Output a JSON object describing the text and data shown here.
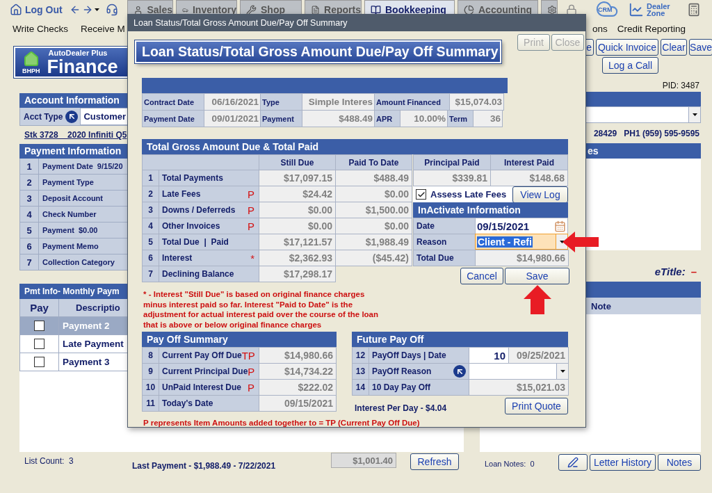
{
  "topbar": {
    "logout": "Log Out",
    "tabs": [
      {
        "label": "Sales",
        "selected": false
      },
      {
        "label": "Inventory",
        "selected": false
      },
      {
        "label": "Shop",
        "selected": false
      },
      {
        "label": "Reports",
        "selected": false
      },
      {
        "label": "Bookkeeping",
        "selected": true
      },
      {
        "label": "Accounting",
        "selected": false
      }
    ],
    "crm": "CRM",
    "dealer_zone": "Dealer Zone"
  },
  "menu": {
    "left": [
      "Write Checks",
      "Receive M"
    ],
    "right": [
      "ons",
      "Credit Reporting"
    ]
  },
  "logo": {
    "badge": "BHPH",
    "subtitle": "AutoDealer Plus",
    "title": "Finance"
  },
  "toolbar": {
    "buttons": [
      "e",
      "Quick Invoice",
      "Clear",
      "Save"
    ],
    "log_call": "Log a Call"
  },
  "account": {
    "title": "Account Information",
    "type_label": "Acct Type",
    "type_value": "Customer",
    "vehicle": "Stk 3728    2020 Infiniti Q5"
  },
  "payment_info": {
    "title": "Payment Information",
    "rows": [
      {
        "num": "1",
        "label": "Payment Date  9/15/20"
      },
      {
        "num": "2",
        "label": "Payment Type"
      },
      {
        "num": "3",
        "label": "Deposit Account"
      },
      {
        "num": "4",
        "label": "Check Number"
      },
      {
        "num": "5",
        "label": "Payment  $0.00"
      },
      {
        "num": "6",
        "label": "Payment Memo"
      },
      {
        "num": "7",
        "label": "Collection Category"
      }
    ]
  },
  "pmt": {
    "title": "Pmt Info- Monthly Paym",
    "columns": [
      "Pay",
      "Descriptio"
    ],
    "rows": [
      {
        "label": "Payment 2",
        "checked": false,
        "selected": true
      },
      {
        "label": "Late Payment",
        "checked": false,
        "selected": false
      },
      {
        "label": "Payment 3",
        "checked": false,
        "selected": false
      }
    ]
  },
  "left_footer": {
    "list_count": "List Count:  3",
    "last_payment": "Last Payment - $1,988.49 - 7/22/2021",
    "amount": "$1,001.40",
    "refresh": "Refresh"
  },
  "right": {
    "pid": "PID: 3487",
    "contact": [
      "28429",
      "PH1 (959) 595-9595"
    ],
    "notes_header": "es",
    "etitle_label": "eTitle:",
    "etitle_value": "–",
    "note_column": "Note",
    "loan_notes": "Loan Notes:  0",
    "buttons": [
      "Letter History",
      "Notes"
    ]
  },
  "modal": {
    "title": "Loan Status/Total Gross Amount Due/Pay Off Summary",
    "banner": "Loan Status/Total Gross Amount Due/Pay Off Summary",
    "buttons": [
      {
        "label": "Print",
        "disabled": true
      },
      {
        "label": "Close",
        "disabled": true
      }
    ],
    "contract": [
      [
        {
          "text": "Contract Date",
          "kind": "label"
        },
        {
          "text": "06/16/2021",
          "kind": "value"
        },
        {
          "text": "Type",
          "kind": "label"
        },
        {
          "text": "Simple Interes",
          "kind": "value"
        },
        {
          "text": "Amount Financed",
          "kind": "label"
        },
        {
          "text": "$15,074.03",
          "kind": "value"
        }
      ],
      [
        {
          "text": "Payment Date",
          "kind": "label"
        },
        {
          "text": "09/01/2021",
          "kind": "value"
        },
        {
          "text": "Payment",
          "kind": "label"
        },
        {
          "text": "$488.49",
          "kind": "value"
        },
        {
          "text": "APR",
          "kind": "label"
        },
        {
          "text": "10.00%",
          "kind": "value"
        },
        {
          "text": "Term",
          "kind": "label"
        },
        {
          "text": "36",
          "kind": "value"
        }
      ]
    ],
    "gross": {
      "title": "Total Gross Amount Due & Total Paid",
      "columns": [
        "Still Due",
        "Paid To Date",
        "Principal Paid",
        "Interest Paid"
      ],
      "rows": [
        {
          "num": "1",
          "label": "Total Payments",
          "values": [
            "$17,097.15",
            "$488.49",
            "$339.81",
            "$148.68"
          ]
        },
        {
          "num": "2",
          "label": "Late Fees",
          "marker": "P",
          "values": [
            "$24.42",
            "$0.00"
          ]
        },
        {
          "num": "3",
          "label": "Downs / Deferreds",
          "marker": "P",
          "values": [
            "$0.00",
            "$1,500.00"
          ]
        },
        {
          "num": "4",
          "label": "Other Invoices",
          "marker": "P",
          "values": [
            "$0.00",
            "$0.00"
          ]
        },
        {
          "num": "5",
          "label": "Total Due  |  Paid",
          "values": [
            "$17,121.57",
            "$1,988.49"
          ]
        },
        {
          "num": "6",
          "label": "Interest",
          "marker": "*",
          "values": [
            "$2,362.93",
            "($45.42)"
          ]
        },
        {
          "num": "7",
          "label": "Declining Balance",
          "values": [
            "$17,298.17"
          ]
        }
      ]
    },
    "late_fees": {
      "label": "Assess Late Fees",
      "checked": true
    },
    "view_log": "View Log",
    "inactivate": {
      "title": "InActivate Information",
      "date_label": "Date",
      "date": "09/15/2021",
      "reason_label": "Reason",
      "reason": "Client - Refi",
      "total_label": "Total Due",
      "total": "$14,980.66",
      "cancel": "Cancel",
      "save": "Save"
    },
    "footnote": "* - Interest \"Still Due\" is based on original finance charges minus interest paid so far. Interest \"Paid to Date\" is the adjustment for actual interest paid over the course of the loan that is above or below original finance charges",
    "payoff": {
      "title": "Pay Off Summary",
      "rows": [
        {
          "num": "8",
          "label": "Current Pay Off Due",
          "marker": "TP",
          "value": "$14,980.66"
        },
        {
          "num": "9",
          "label": "Current Principal Due",
          "marker": "P",
          "value": "$14,734.22"
        },
        {
          "num": "10",
          "label": "UnPaid Interest Due",
          "marker": "P",
          "value": "$222.02"
        },
        {
          "num": "11",
          "label": "Today's Date",
          "value": "09/15/2021"
        }
      ]
    },
    "future": {
      "title": "Future Pay Off",
      "rows": [
        {
          "num": "12",
          "label": "PayOff Days | Date",
          "kind": "days",
          "days": "10",
          "date": "09/25/2021"
        },
        {
          "num": "13",
          "label": "PayOff Reason",
          "kind": "select"
        },
        {
          "num": "14",
          "label": "10 Day Pay Off",
          "kind": "value",
          "value": "$15,021.03"
        }
      ]
    },
    "interest_per_day": "Interest Per Day - $4.04",
    "print_quote": "Print Quote",
    "legend": "P represents Item Amounts added together to = TP (Current Pay Off Due)"
  }
}
